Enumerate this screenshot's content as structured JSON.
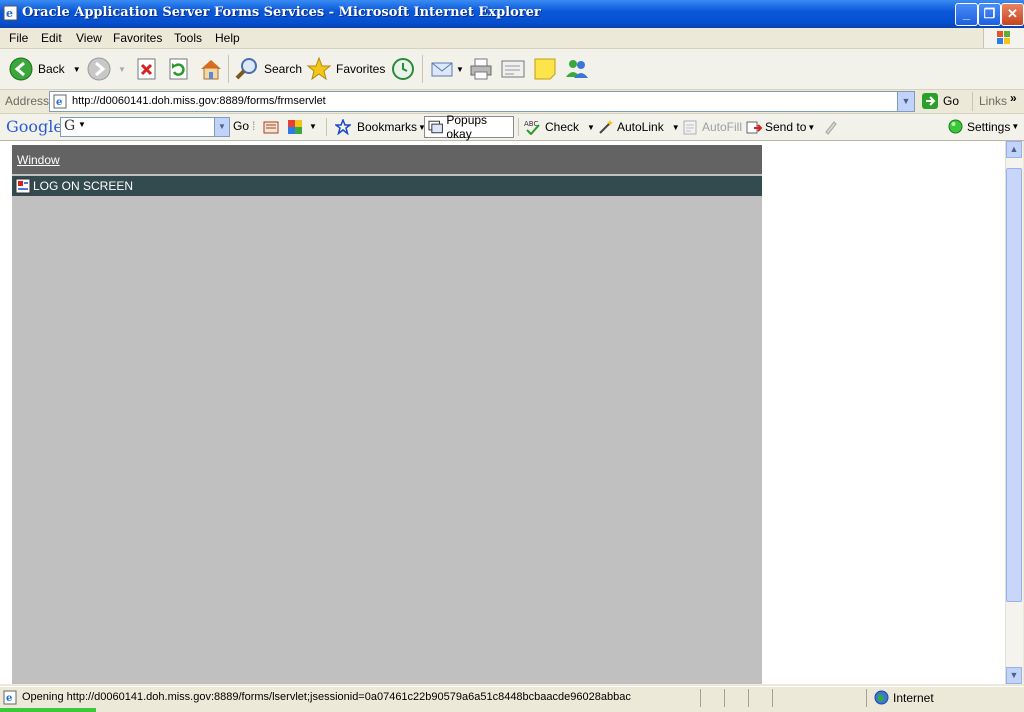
{
  "window": {
    "title": "Oracle Application Server Forms Services - Microsoft Internet Explorer",
    "minimize": "_",
    "maximize": "❐",
    "close": "✕"
  },
  "menu": {
    "items": [
      "File",
      "Edit",
      "View",
      "Favorites",
      "Tools",
      "Help"
    ]
  },
  "toolbar": {
    "back": "Back",
    "search": "Search",
    "favorites": "Favorites"
  },
  "address": {
    "label": "Address",
    "url": "http://d0060141.doh.miss.gov:8889/forms/frmservlet",
    "go": "Go",
    "links": "Links"
  },
  "google_toolbar": {
    "brand": "Google",
    "go": "Go",
    "bookmarks": "Bookmarks",
    "popups": "Popups okay",
    "check": "Check",
    "autolink": "AutoLink",
    "autofill": "AutoFill",
    "sendto": "Send to",
    "settings": "Settings"
  },
  "applet": {
    "menu_label": "Window",
    "window_title": "LOG ON SCREEN"
  },
  "status": {
    "text": "Opening http://d0060141.doh.miss.gov:8889/forms/lservlet;jsessionid=0a07461c22b90579a6a51c8448bcbaacde96028abbac",
    "zone": "Internet"
  },
  "colors": {
    "titlebar": "#0a58d8",
    "applet_bg": "#c0c0c0",
    "applet_menu": "#636363",
    "applet_window": "#334a4f"
  }
}
